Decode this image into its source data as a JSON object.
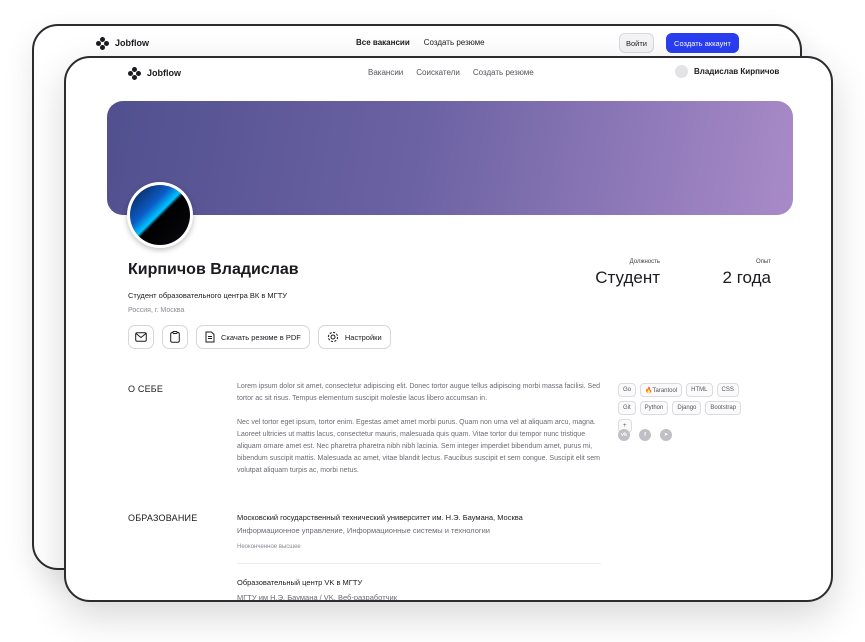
{
  "back_window": {
    "logo": "Jobflow",
    "nav": [
      {
        "label": "Все вакансии",
        "active": true
      },
      {
        "label": "Создать резюме",
        "active": false
      }
    ],
    "login_label": "Войти",
    "signup_label": "Создать аккаунт",
    "accent_color": "#2a3ef0"
  },
  "front_window": {
    "logo": "Jobflow",
    "nav": [
      "Вакансии",
      "Соискатели",
      "Создать резюме"
    ],
    "user_name": "Владислав Кирпичов"
  },
  "profile": {
    "name": "Кирпичов Владислав",
    "subtitle": "Студент образовательного центра ВК в МГТУ",
    "location": "Россия, г. Москва",
    "actions": {
      "mail_icon": "mail-icon",
      "clipboard_icon": "clipboard-icon",
      "download_label": "Скачать резюме в PDF",
      "settings_label": "Настройки"
    },
    "position_label": "Должность",
    "position_value": "Студент",
    "experience_label": "Опыт",
    "experience_value": "2 года"
  },
  "about": {
    "title": "О СЕБЕ",
    "p1": "Lorem ipsum dolor sit amet, consectetur adipiscing elit. Donec tortor augue tellus adipiscing morbi massa facilisi. Sed tortor ac sit risus. Tempus elementum suscipit molestie lacus libero accumsan in.",
    "p2": "Nec vel tortor eget ipsum, tortor enim. Egestas amet amet morbi purus. Quam non urna vel at aliquam arcu, magna. Laoreet ultricies ut mattis lacus, consectetur mauris, malesuada quis quam. Vitae tortor dui tempor nunc tristique aliquam ornare amet est. Nec pharetra pharetra nibh nibh lacinia. Sem integer imperdiet bibendum amet, purus mi, bibendum suscipit mattis. Malesuada ac amet, vitae blandit lectus. Faucibus suscipit et sem congue. Suscipit elit sem volutpat aliquam turpis ac, morbi netus."
  },
  "skills": [
    "Go",
    "🔥Tarantool",
    "HTML",
    "CSS",
    "Git",
    "Python",
    "Django",
    "Bootstrap",
    "+"
  ],
  "socials": [
    {
      "icon": "vk-icon",
      "glyph": "vk"
    },
    {
      "icon": "facebook-icon",
      "glyph": "f"
    },
    {
      "icon": "telegram-icon",
      "glyph": "➤"
    }
  ],
  "education": {
    "title": "ОБРАЗОВАНИЕ",
    "items": [
      {
        "title": "Московский государственный технический университет им. Н.Э. Баумана, Москва",
        "subtitle": "Информационное управление, Информационные системы и технологии",
        "level": "Неоконченное высшее"
      },
      {
        "title": "Образовательный центр VK в МГТУ",
        "subtitle": "МГТУ им Н.Э. Баумана / VK, Веб-разработчик"
      }
    ]
  }
}
